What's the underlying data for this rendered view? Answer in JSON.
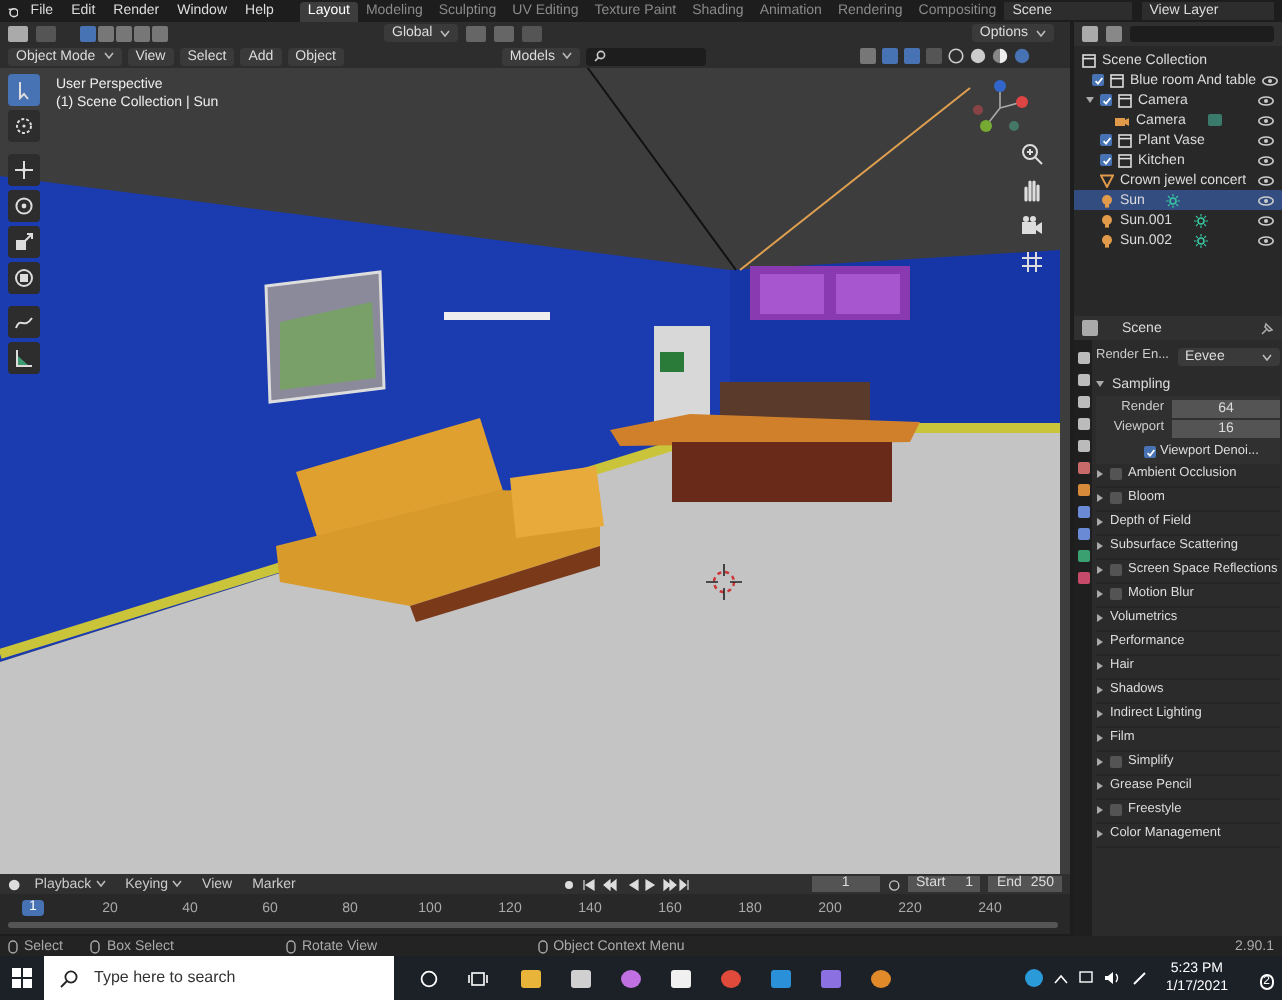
{
  "menu": [
    "File",
    "Edit",
    "Render",
    "Window",
    "Help"
  ],
  "workspaces": [
    {
      "label": "Layout",
      "selected": true
    },
    {
      "label": "Modeling",
      "selected": false
    },
    {
      "label": "Sculpting",
      "selected": false
    },
    {
      "label": "UV Editing",
      "selected": false
    },
    {
      "label": "Texture Paint",
      "selected": false
    },
    {
      "label": "Shading",
      "selected": false
    },
    {
      "label": "Animation",
      "selected": false
    },
    {
      "label": "Rendering",
      "selected": false
    },
    {
      "label": "Compositing",
      "selected": false
    }
  ],
  "scene_field": "Scene",
  "view_layer_field": "View Layer",
  "viewport": {
    "mode": "Object Mode",
    "menus": [
      "View",
      "Select",
      "Add",
      "Object"
    ],
    "orientation": "Global",
    "collection": "Models",
    "options": "Options",
    "overlay_text": [
      "User Perspective",
      "(1) Scene Collection | Sun"
    ],
    "tools": [
      {
        "kind": "select",
        "selected": true
      },
      {
        "kind": "cursor",
        "selected": false
      },
      {
        "kind": "move",
        "selected": false
      },
      {
        "kind": "rotate",
        "selected": false
      },
      {
        "kind": "scale",
        "selected": false
      },
      {
        "kind": "transform",
        "selected": false
      },
      {
        "kind": "annotate",
        "selected": false
      },
      {
        "kind": "measure",
        "selected": false
      }
    ]
  },
  "outliner": {
    "title": "Scene Collection",
    "items": [
      {
        "name": "Blue room And table",
        "kind": "collection",
        "checked": true,
        "selected": false
      },
      {
        "name": "Camera",
        "kind": "collection",
        "checked": true,
        "selected": false,
        "children": [
          {
            "name": "Camera",
            "kind": "camera",
            "selected": false
          }
        ]
      },
      {
        "name": "Plant Vase",
        "kind": "collection",
        "checked": true,
        "selected": false
      },
      {
        "name": "Kitchen",
        "kind": "collection",
        "checked": true,
        "selected": false
      },
      {
        "name": "Crown jewel concert",
        "kind": "mesh",
        "selected": false
      },
      {
        "name": "Sun",
        "kind": "light",
        "selected": true
      },
      {
        "name": "Sun.001",
        "kind": "light",
        "selected": false
      },
      {
        "name": "Sun.002",
        "kind": "light",
        "selected": false
      }
    ]
  },
  "properties": {
    "context": "Scene",
    "render_engine": {
      "label": "Render En...",
      "value": "Eevee"
    },
    "sampling": {
      "title": "Sampling",
      "fields": [
        {
          "label": "Render",
          "value": "64"
        },
        {
          "label": "Viewport",
          "value": "16"
        }
      ],
      "denoise": {
        "label": "Viewport Denoi...",
        "checked": true
      }
    },
    "panels": [
      {
        "title": "Ambient Occlusion",
        "kind": "toggle",
        "checked": false
      },
      {
        "title": "Bloom",
        "kind": "toggle",
        "checked": false
      },
      {
        "title": "Depth of Field",
        "kind": "plain"
      },
      {
        "title": "Subsurface Scattering",
        "kind": "plain"
      },
      {
        "title": "Screen Space Reflections",
        "kind": "toggle",
        "checked": false
      },
      {
        "title": "Motion Blur",
        "kind": "toggle",
        "checked": false
      },
      {
        "title": "Volumetrics",
        "kind": "plain"
      },
      {
        "title": "Performance",
        "kind": "plain"
      },
      {
        "title": "Hair",
        "kind": "plain"
      },
      {
        "title": "Shadows",
        "kind": "plain"
      },
      {
        "title": "Indirect Lighting",
        "kind": "plain"
      },
      {
        "title": "Film",
        "kind": "plain"
      },
      {
        "title": "Simplify",
        "kind": "toggle",
        "checked": false
      },
      {
        "title": "Grease Pencil",
        "kind": "plain"
      },
      {
        "title": "Freestyle",
        "kind": "toggle",
        "checked": false
      },
      {
        "title": "Color Management",
        "kind": "plain"
      }
    ]
  },
  "timeline": {
    "menus": [
      "Playback",
      "Keying",
      "View",
      "Marker"
    ],
    "current_frame": "1",
    "start": {
      "label": "Start",
      "value": "1"
    },
    "end": {
      "label": "End",
      "value": "250"
    },
    "playhead": "1",
    "ticks": [
      "20",
      "40",
      "60",
      "80",
      "100",
      "120",
      "140",
      "160",
      "180",
      "200",
      "220",
      "240"
    ]
  },
  "status_bar": {
    "hints": [
      "Select",
      "Box Select",
      "Rotate View",
      "Object Context Menu"
    ],
    "version": "2.90.1"
  },
  "taskbar": {
    "search_placeholder": "Type here to search",
    "time": "5:23 PM",
    "date": "1/17/2021",
    "notifications": "2"
  }
}
